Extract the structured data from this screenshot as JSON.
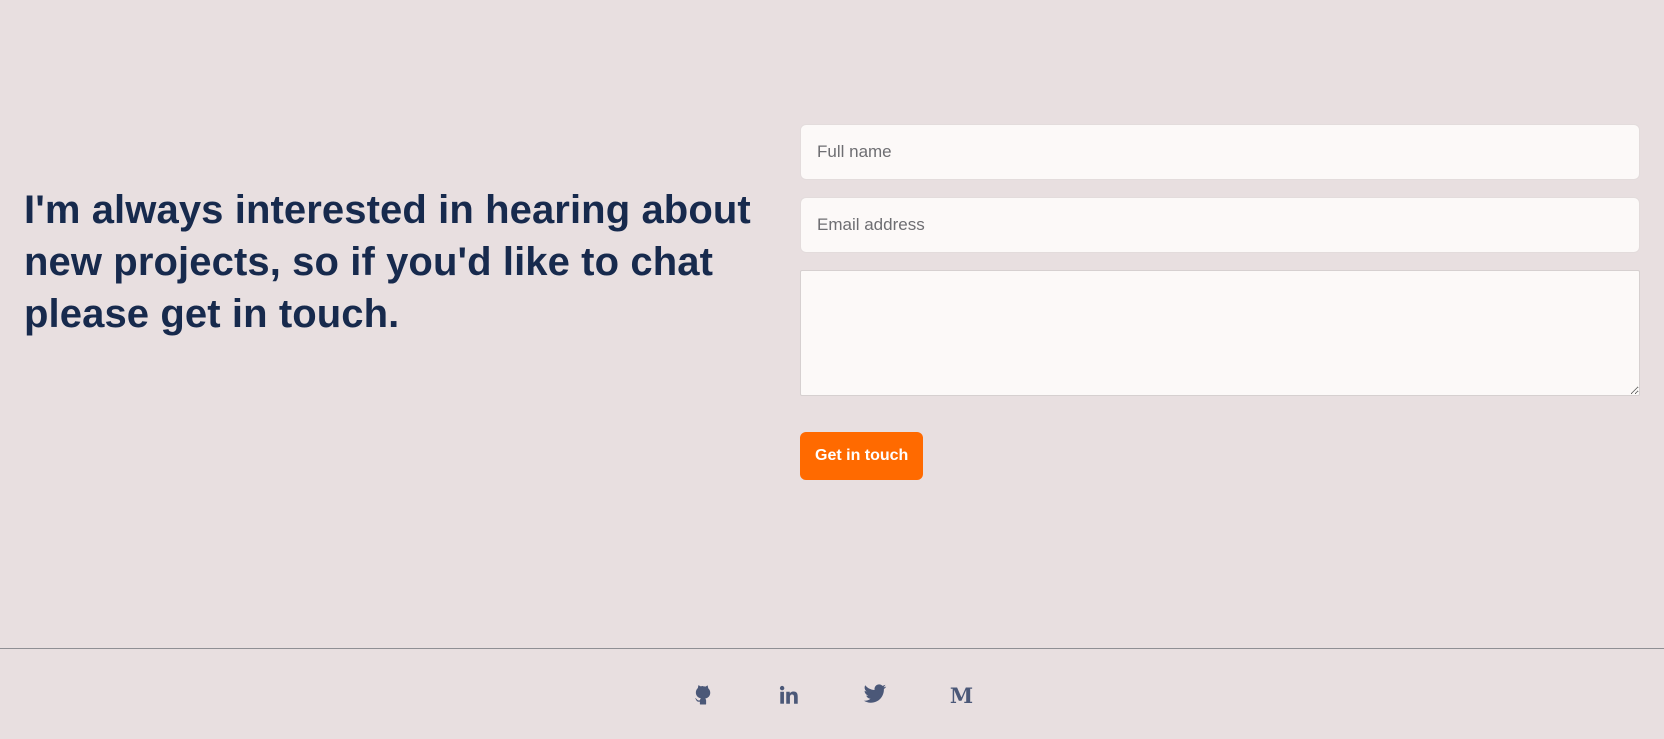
{
  "contact": {
    "heading": "I'm always interested in hearing about new projects, so if you'd like to chat please get in touch.",
    "form": {
      "name_placeholder": "Full name",
      "email_placeholder": "Email address",
      "message_placeholder": "",
      "submit_label": "Get in touch"
    }
  },
  "footer": {
    "social": [
      {
        "icon": "github-icon"
      },
      {
        "icon": "linkedin-icon"
      },
      {
        "icon": "twitter-icon"
      },
      {
        "icon": "medium-icon",
        "glyph": "M"
      }
    ]
  },
  "colors": {
    "background": "#e8dfe0",
    "heading": "#172a4d",
    "accent": "#ff6a00",
    "icon": "#4b5878"
  }
}
